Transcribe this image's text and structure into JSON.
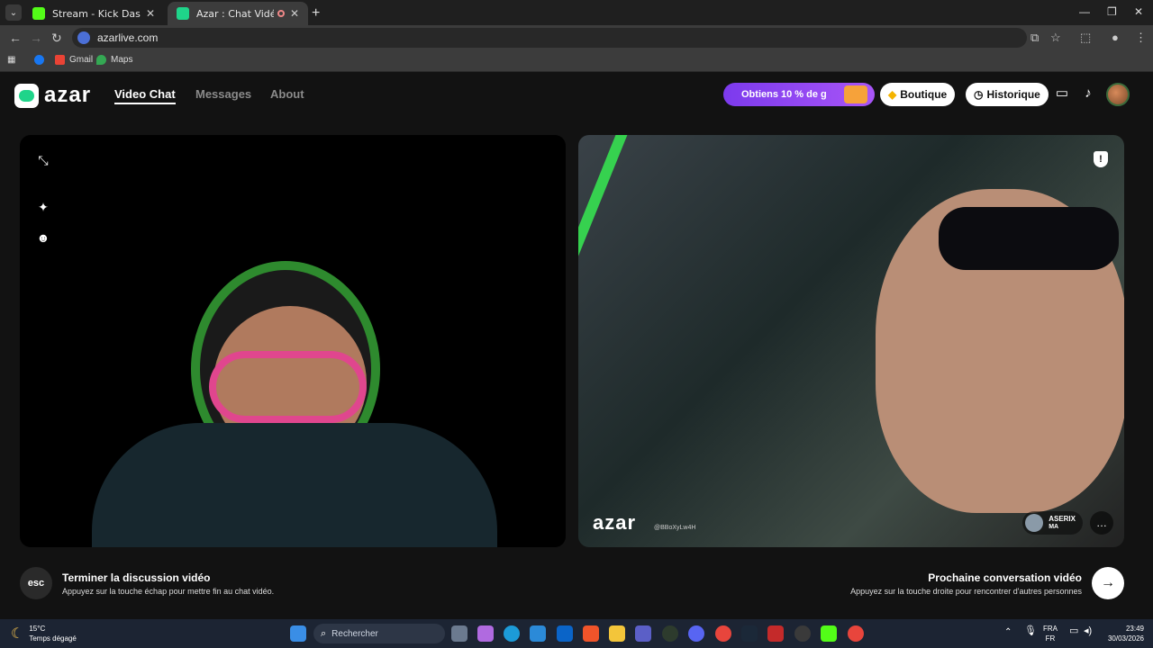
{
  "browser": {
    "tabs": [
      {
        "title": "Stream - Kick Dashboard",
        "favicon_color": "#53fc18"
      },
      {
        "title": "Azar : Chat Vidéo avec de n",
        "favicon_color": "#1fd48a"
      }
    ],
    "url": "azarlive.com",
    "bookmarks": [
      {
        "label": "",
        "icon": "facebook-icon",
        "color": "#1877f2"
      },
      {
        "label": "Gmail",
        "icon": "gmail-icon",
        "color": "#ea4335"
      },
      {
        "label": "Maps",
        "icon": "maps-icon",
        "color": "#34a853"
      }
    ]
  },
  "app": {
    "logo": "azar",
    "nav": {
      "video_chat": "Video Chat",
      "messages": "Messages",
      "about": "About"
    },
    "promo": "Obtiens 10 % de g",
    "boutique": "Boutique",
    "historique": "Historique",
    "watermark": "azar",
    "watermark_id": "@BBoXyLw4H",
    "partner": {
      "name": "ASERIX",
      "country": "MA"
    },
    "esc_label": "esc",
    "end": {
      "title": "Terminer la discussion vidéo",
      "subtitle": "Appuyez sur la touche échap pour mettre fin au chat vidéo."
    },
    "next": {
      "title": "Prochaine conversation vidéo",
      "subtitle": "Appuyez sur la touche droite pour rencontrer d'autres personnes"
    }
  },
  "taskbar": {
    "weather_temp": "15°C",
    "weather_desc": "Temps dégagé",
    "search_placeholder": "Rechercher",
    "lang_top": "FRA",
    "lang_bottom": "FR",
    "time": "23:49",
    "date": "30/03/2026"
  }
}
